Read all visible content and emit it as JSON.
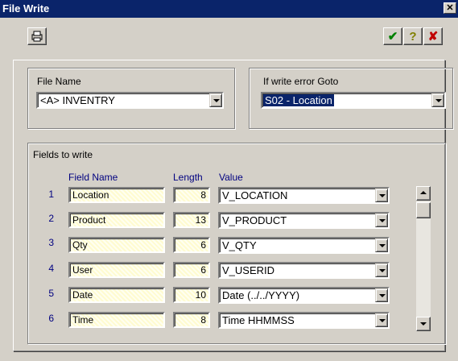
{
  "window": {
    "title": "File Write"
  },
  "toolbar": {
    "print_icon": "printer-icon",
    "ok_icon": "checkmark-icon",
    "help_icon": "question-icon",
    "cancel_icon": "x-icon"
  },
  "file_name": {
    "label": "File Name",
    "value": "<A> INVENTRY"
  },
  "error_goto": {
    "label": "If write error Goto",
    "value": "S02 - Location"
  },
  "fields": {
    "group_label": "Fields to write",
    "headers": {
      "name": "Field Name",
      "length": "Length",
      "value": "Value"
    },
    "rows": [
      {
        "num": "1",
        "name": "Location",
        "length": "8",
        "value": "V_LOCATION"
      },
      {
        "num": "2",
        "name": "Product",
        "length": "13",
        "value": "V_PRODUCT"
      },
      {
        "num": "3",
        "name": "Qty",
        "length": "6",
        "value": "V_QTY"
      },
      {
        "num": "4",
        "name": "User",
        "length": "6",
        "value": "V_USERID"
      },
      {
        "num": "5",
        "name": "Date",
        "length": "10",
        "value": "Date (../../YYYY)"
      },
      {
        "num": "6",
        "name": "Time",
        "length": "8",
        "value": "Time HHMMSS"
      }
    ]
  }
}
